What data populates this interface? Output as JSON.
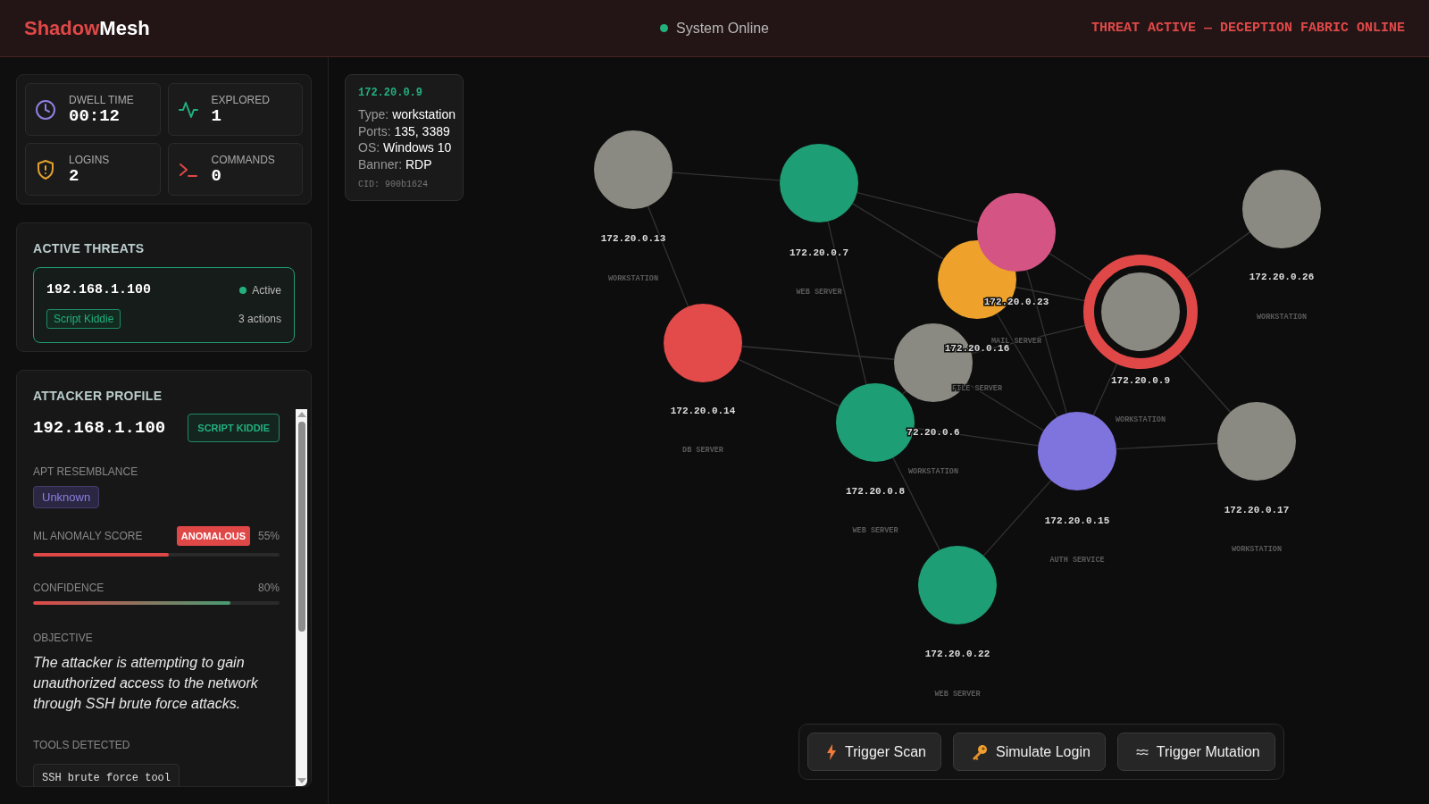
{
  "header": {
    "logo": {
      "accent": "Shadow",
      "rest": "Mesh"
    },
    "status": {
      "label": "System Online",
      "online": true
    },
    "banner": "THREAT ACTIVE — DECEPTION FABRIC ONLINE"
  },
  "stats": [
    {
      "kind": "clock",
      "label": "DWELL TIME",
      "value": "00:12"
    },
    {
      "kind": "pulse",
      "label": "EXPLORED",
      "value": "1"
    },
    {
      "kind": "shield",
      "label": "LOGINS",
      "value": "2"
    },
    {
      "kind": "terminal",
      "label": "COMMANDS",
      "value": "0"
    }
  ],
  "active_threats": {
    "title": "ACTIVE THREATS",
    "items": [
      {
        "ip": "192.168.1.100",
        "status": "Active",
        "tag": "Script Kiddie",
        "actions": "3 actions",
        "selected": true
      }
    ]
  },
  "attacker_profile": {
    "title": "ATTACKER PROFILE",
    "ip": "192.168.1.100",
    "classification": "SCRIPT KIDDIE",
    "apt_label": "APT RESEMBLANCE",
    "apt_value": "Unknown",
    "anomaly": {
      "label": "ML ANOMALY SCORE",
      "badge": "ANOMALOUS",
      "reading": "55%",
      "level": 0.55
    },
    "confidence": {
      "label": "CONFIDENCE",
      "reading": "80%",
      "level": 0.8
    },
    "objective_label": "OBJECTIVE",
    "objective": "The attacker is attempting to gain unauthorized access to the network through SSH brute force attacks.",
    "tools_label": "TOOLS DETECTED",
    "tools": [
      "SSH brute force tool"
    ]
  },
  "node_details": {
    "ip": "172.20.0.9",
    "fields": [
      {
        "label": "Type:",
        "value": "workstation"
      },
      {
        "label": "Ports:",
        "value": "135, 3389"
      },
      {
        "label": "OS:",
        "value": "Windows 10"
      },
      {
        "label": "Banner:",
        "value": "RDP"
      }
    ],
    "cid": "CID: 900b1624"
  },
  "nodes": [
    {
      "ip": "172.20.0.13",
      "type": "WORKSTATION",
      "color": "#8a8a82",
      "selected": false
    },
    {
      "ip": "172.20.0.7",
      "type": "WEB SERVER",
      "color": "#1e9e74",
      "selected": false
    },
    {
      "ip": "172.20.0.16",
      "type": "FILE SERVER",
      "color": "#eea12b",
      "selected": false
    },
    {
      "ip": "172.20.0.23",
      "type": "MAIL SERVER",
      "color": "#d45583",
      "selected": false
    },
    {
      "ip": "172.20.0.14",
      "type": "DB SERVER",
      "color": "#e24b4a",
      "selected": false
    },
    {
      "ip": "72.20.0.6",
      "type": "WORKSTATION",
      "color": "#8a8a82",
      "selected": false
    },
    {
      "ip": "172.20.0.8",
      "type": "WEB SERVER",
      "color": "#1e9e74",
      "selected": false
    },
    {
      "ip": "172.20.0.9",
      "type": "WORKSTATION",
      "color": "#8a8a82",
      "selected": true
    },
    {
      "ip": "172.20.0.26",
      "type": "WORKSTATION",
      "color": "#8a8a82",
      "selected": false
    },
    {
      "ip": "172.20.0.15",
      "type": "AUTH SERVICE",
      "color": "#7f74de",
      "selected": false
    },
    {
      "ip": "172.20.0.17",
      "type": "WORKSTATION",
      "color": "#8a8a82",
      "selected": false
    },
    {
      "ip": "172.20.0.22",
      "type": "WEB SERVER",
      "color": "#1e9e74",
      "selected": false
    }
  ],
  "actions": [
    {
      "kind": "scan",
      "label": "Trigger Scan"
    },
    {
      "kind": "login",
      "label": "Simulate Login"
    },
    {
      "kind": "mutation",
      "label": "Trigger Mutation"
    }
  ]
}
